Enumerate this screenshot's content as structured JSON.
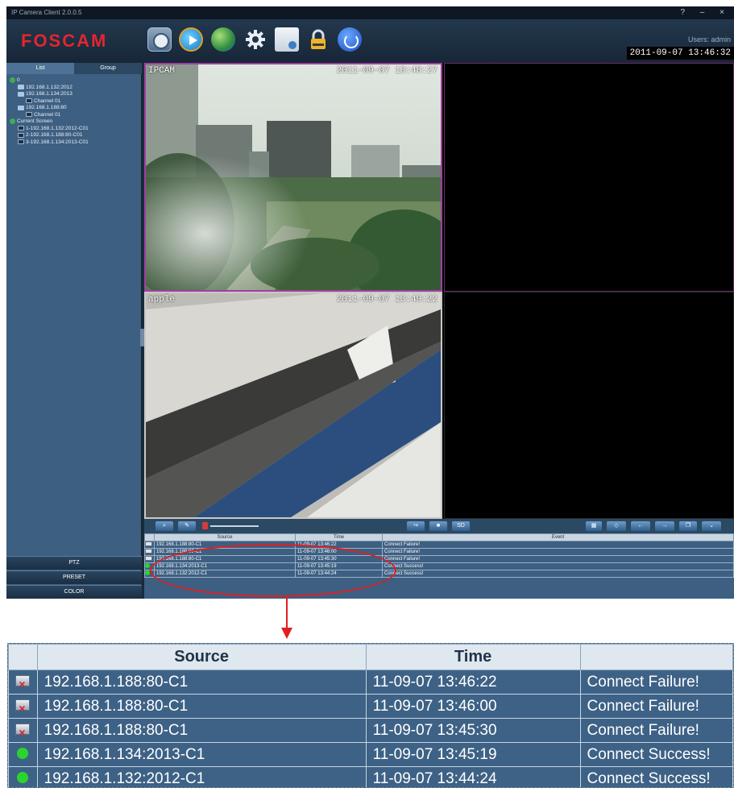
{
  "window": {
    "title": "IP Camera Client 2.0.0.5",
    "controls": "? – ×"
  },
  "header": {
    "logo": "FOSCAM",
    "users_label": "Users: admin",
    "datetime": "2011-09-07 13:46:32",
    "toolbar_icons": [
      "live-view-icon",
      "playback-icon",
      "map-icon",
      "settings-icon",
      "record-icon",
      "lock-icon",
      "power-icon"
    ]
  },
  "sidebar": {
    "tabs": [
      "List",
      "Group"
    ],
    "tree": [
      {
        "level": 0,
        "icon": "globe",
        "label": "0"
      },
      {
        "level": 1,
        "icon": "device",
        "label": "192.168.1.132:2012"
      },
      {
        "level": 1,
        "icon": "device",
        "label": "192.168.1.134:2013"
      },
      {
        "level": 2,
        "icon": "channel",
        "label": "Channel 01"
      },
      {
        "level": 1,
        "icon": "device",
        "label": "192.168.1.188:80"
      },
      {
        "level": 2,
        "icon": "channel",
        "label": "Channel 01"
      },
      {
        "level": 0,
        "icon": "globe",
        "label": "Current Screen"
      },
      {
        "level": 1,
        "icon": "channel",
        "label": "1-192.168.1.132:2012-C01"
      },
      {
        "level": 1,
        "icon": "channel",
        "label": "2-192.168.1.188:80-C01"
      },
      {
        "level": 1,
        "icon": "channel",
        "label": "3-192.168.1.134:2013-C01"
      }
    ],
    "buttons": {
      "ptz": "PTZ",
      "preset": "PRESET",
      "color": "COLOR"
    }
  },
  "video": {
    "cell1": {
      "name": "IPCAM",
      "timestamp": "2011-09-07 13:48:27"
    },
    "cell3": {
      "name": "apple",
      "timestamp": "2011-09-07 13:49:22"
    }
  },
  "controls": {
    "sd_label": "SD"
  },
  "log": {
    "headers": {
      "source": "Source",
      "time": "Time",
      "event": "Event"
    },
    "rows": [
      {
        "status": "fail",
        "source": "192.168.1.188:80-C1",
        "time": "11-09-07 13:46:22",
        "event": "Connect Failure!"
      },
      {
        "status": "fail",
        "source": "192.168.1.188:80-C1",
        "time": "11-09-07 13:46:00",
        "event": "Connect Failure!"
      },
      {
        "status": "fail",
        "source": "192.168.1.188:80-C1",
        "time": "11-09-07 13:45:30",
        "event": "Connect Failure!"
      },
      {
        "status": "ok",
        "source": "192.168.1.134:2013-C1",
        "time": "11-09-07 13:45:19",
        "event": "Connect Success!"
      },
      {
        "status": "ok",
        "source": "192.168.1.132:2012-C1",
        "time": "11-09-07 13:44:24",
        "event": "Connect Success!"
      }
    ]
  },
  "colors": {
    "annotation": "#e11f1f",
    "panel": "#3d5f82",
    "logo": "#e3262e"
  }
}
